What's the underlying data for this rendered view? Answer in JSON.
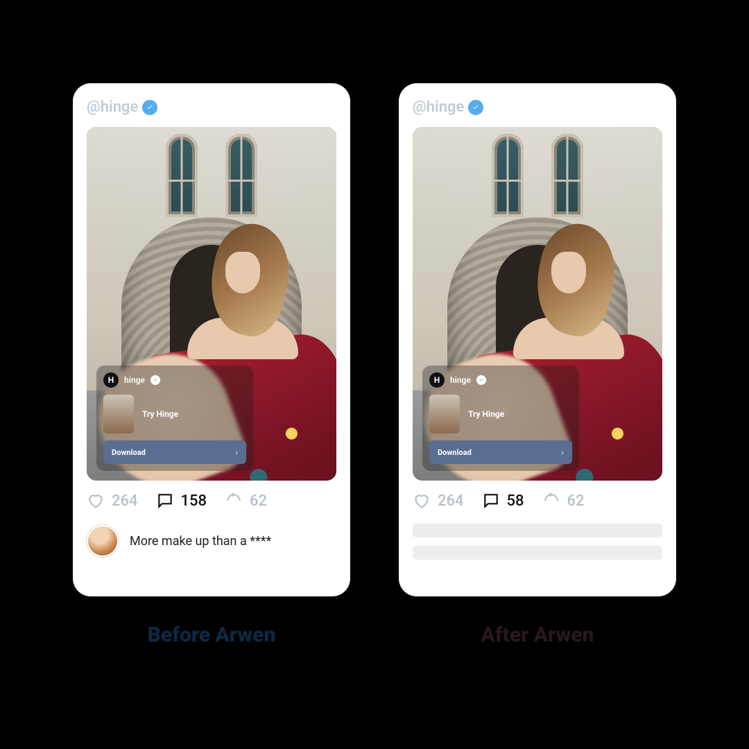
{
  "before": {
    "handle": "@hinge",
    "promo": {
      "brand": "hinge",
      "cta": "Try Hinge",
      "download": "Download"
    },
    "stats": {
      "likes": "264",
      "comments": "158",
      "shares": "62"
    },
    "comment": "More make up than a ****",
    "caption": "Before Arwen"
  },
  "after": {
    "handle": "@hinge",
    "promo": {
      "brand": "hinge",
      "cta": "Try Hinge",
      "download": "Download"
    },
    "stats": {
      "likes": "264",
      "comments": "58",
      "shares": "62"
    },
    "caption": "After Arwen"
  }
}
